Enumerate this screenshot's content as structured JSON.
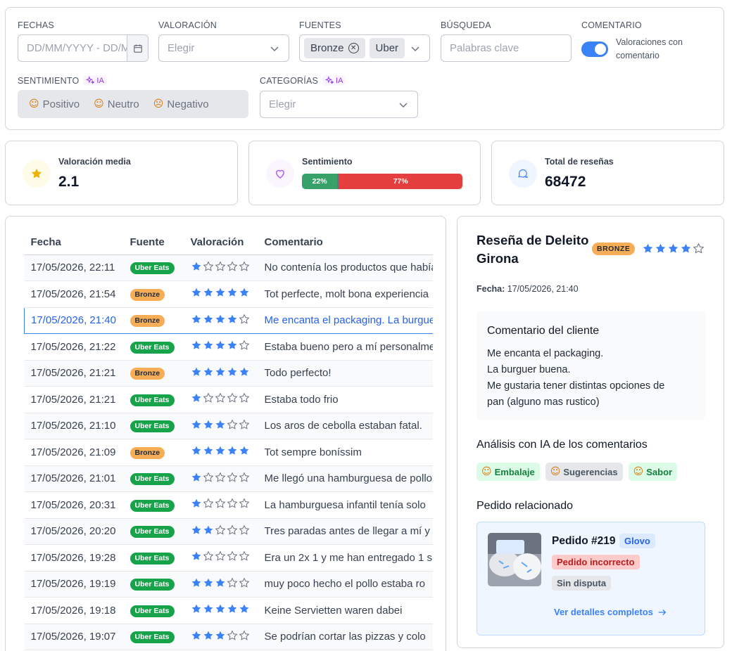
{
  "filters": {
    "fechas": {
      "label": "FECHAS",
      "placeholder": "DD/MM/YYYY - DD/MM/YYYY"
    },
    "valoracion": {
      "label": "VALORACIÓN",
      "placeholder": "Elegir"
    },
    "fuentes": {
      "label": "FUENTES",
      "tags": [
        "Bronze",
        "Uber"
      ]
    },
    "busqueda": {
      "label": "BÚSQUEDA",
      "placeholder": "Palabras clave"
    },
    "comentario": {
      "label": "COMENTARIO",
      "toggle_text_1": "Valoraciones con",
      "toggle_text_2": "comentario",
      "enabled": true
    },
    "sentimiento": {
      "label": "SENTIMIENTO",
      "ia": "IA",
      "options": [
        "Positivo",
        "Neutro",
        "Negativo"
      ]
    },
    "categorias": {
      "label": "CATEGORÍAS",
      "ia": "IA",
      "placeholder": "Elegir"
    }
  },
  "stats": {
    "rating": {
      "label": "Valoración media",
      "value": "2.1"
    },
    "sentiment": {
      "label": "Sentimiento",
      "positive": "22%",
      "negative": "77%",
      "positive_pct": 22,
      "neutral_pct": 1,
      "negative_pct": 77
    },
    "total": {
      "label": "Total de reseñas",
      "value": "68472"
    }
  },
  "table": {
    "headers": [
      "Fecha",
      "Fuente",
      "Valoración",
      "Comentario"
    ],
    "rows": [
      {
        "fecha": "17/05/2026, 22:11",
        "fuente": "Uber Eats",
        "rating": 1,
        "comentario": "No contenía los productos que había pedido"
      },
      {
        "fecha": "17/05/2026, 21:54",
        "fuente": "Bronze",
        "rating": 5,
        "comentario": "Tot perfecte, molt bona experiencia"
      },
      {
        "fecha": "17/05/2026, 21:40",
        "fuente": "Bronze",
        "rating": 4,
        "comentario": "Me encanta el packaging. La burguer buena."
      },
      {
        "fecha": "17/05/2026, 21:22",
        "fuente": "Uber Eats",
        "rating": 4,
        "comentario": "Estaba bueno pero a mí personalmente"
      },
      {
        "fecha": "17/05/2026, 21:21",
        "fuente": "Bronze",
        "rating": 5,
        "comentario": "Todo perfecto!"
      },
      {
        "fecha": "17/05/2026, 21:21",
        "fuente": "Uber Eats",
        "rating": 1,
        "comentario": "Estaba todo frio"
      },
      {
        "fecha": "17/05/2026, 21:10",
        "fuente": "Uber Eats",
        "rating": 3,
        "comentario": "Los aros de cebolla estaban fatal."
      },
      {
        "fecha": "17/05/2026, 21:09",
        "fuente": "Bronze",
        "rating": 5,
        "comentario": "Tot sempre boníssim"
      },
      {
        "fecha": "17/05/2026, 21:01",
        "fuente": "Uber Eats",
        "rating": 1,
        "comentario": "Me llegó una hamburguesa de pollo"
      },
      {
        "fecha": "17/05/2026, 20:31",
        "fuente": "Uber Eats",
        "rating": 1,
        "comentario": "La hamburguesa infantil tenía solo"
      },
      {
        "fecha": "17/05/2026, 20:20",
        "fuente": "Uber Eats",
        "rating": 2,
        "comentario": "Tres paradas antes de llegar a mí y"
      },
      {
        "fecha": "17/05/2026, 19:28",
        "fuente": "Uber Eats",
        "rating": 1,
        "comentario": "Era un 2x 1 y me han entregado 1 s"
      },
      {
        "fecha": "17/05/2026, 19:19",
        "fuente": "Uber Eats",
        "rating": 3,
        "comentario": "muy poco hecho el pollo estaba ro"
      },
      {
        "fecha": "17/05/2026, 19:18",
        "fuente": "Uber Eats",
        "rating": 5,
        "comentario": "Keine Servietten waren dabei"
      },
      {
        "fecha": "17/05/2026, 19:07",
        "fuente": "Uber Eats",
        "rating": 3,
        "comentario": "Se podrían cortar las pizzas y colo"
      }
    ]
  },
  "detail": {
    "title": "Reseña de Deleito Girona",
    "source_badge": "BRONZE",
    "rating": 4,
    "date_label": "Fecha:",
    "date_value": "17/05/2026, 21:40",
    "comment_title": "Comentario del cliente",
    "comment_lines": [
      "Me encanta el packaging.",
      "La burguer buena.",
      "Me gustaria tener distintas opciones de",
      "pan (alguno mas rustico)"
    ],
    "analysis_title": "Análisis con IA de los comentarios",
    "chips": [
      "Embalaje",
      "Sugerencias",
      "Sabor"
    ],
    "order_title": "Pedido relacionado",
    "order": {
      "number": "Pedido #219",
      "platform": "Glovo",
      "status": "Pedido incorrecto",
      "dispute": "Sin disputa",
      "link": "Ver detalles completos"
    }
  },
  "colors": {
    "accent": "#3b82f6",
    "star": "#3b82f6",
    "uber": "#16a34a",
    "bronze": "#f6ad55",
    "negative": "#e53e3e",
    "positive": "#38a169"
  }
}
